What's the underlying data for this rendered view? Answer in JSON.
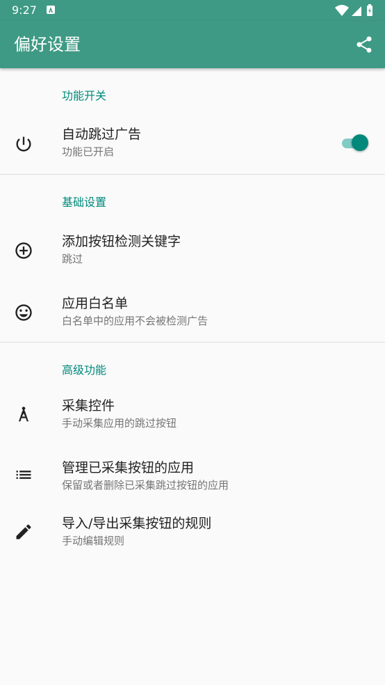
{
  "status_bar": {
    "time": "9:27",
    "notification_icon": "a-letter-icon",
    "icons": [
      "wifi-icon",
      "signal-icon",
      "battery-icon"
    ]
  },
  "app_bar": {
    "title": "偏好设置",
    "share_icon": "share-icon"
  },
  "colors": {
    "primary": "#3E9A84",
    "accent": "#00897B",
    "switch_track": "#80CBC4",
    "background": "#FAFAFA"
  },
  "sections": [
    {
      "header": "功能开关",
      "items": [
        {
          "icon": "power-icon",
          "title": "自动跳过广告",
          "summary": "功能已开启",
          "switch_on": true
        }
      ]
    },
    {
      "header": "基础设置",
      "items": [
        {
          "icon": "add-circle-icon",
          "title": "添加按钮检测关键字",
          "summary": "跳过"
        },
        {
          "icon": "smiley-icon",
          "title": "应用白名单",
          "summary": "白名单中的应用不会被检测广告"
        }
      ]
    },
    {
      "header": "高级功能",
      "items": [
        {
          "icon": "compass-icon",
          "title": "采集控件",
          "summary": "手动采集应用的跳过按钮"
        },
        {
          "icon": "list-icon",
          "title": "管理已采集按钮的应用",
          "summary": "保留或者删除已采集跳过按钮的应用"
        },
        {
          "icon": "pencil-icon",
          "title": "导入/导出采集按钮的规则",
          "summary": "手动编辑规则"
        }
      ]
    }
  ]
}
